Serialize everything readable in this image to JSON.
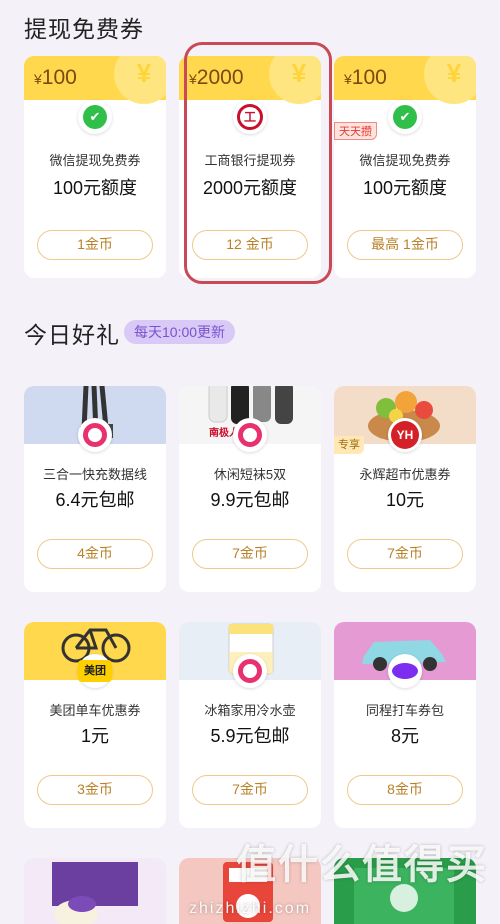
{
  "sections": {
    "withdraw_title": "提现免费券",
    "daily_title": "今日好礼",
    "daily_badge": "每天10:00更新"
  },
  "withdraw_cards": [
    {
      "amount_symbol": "¥",
      "amount": "100",
      "coin_mark": "¥",
      "logo": "wechat-pay-icon",
      "name": "微信提现免费券",
      "value": "100元额度",
      "button": "1金币"
    },
    {
      "amount_symbol": "¥",
      "amount": "2000",
      "coin_mark": "¥",
      "logo": "icbc-logo-icon",
      "name": "工商银行提现券",
      "value": "2000元额度",
      "button": "12 金币"
    },
    {
      "amount_symbol": "¥",
      "amount": "100",
      "coin_mark": "¥",
      "logo": "wechat-pay-icon",
      "tag": "天天攒",
      "name": "微信提现免费券",
      "value": "100元额度",
      "button": "最高 1金币"
    }
  ],
  "gift_cards_row1": [
    {
      "image": "usb-cable-product-image",
      "logo": "store-logo-icon",
      "name": "三合一快充数据线",
      "value": "6.4元包邮",
      "button": "4金币"
    },
    {
      "image": "socks-product-image",
      "image_text": "南极人",
      "logo": "store-logo-icon",
      "name": "休闲短袜5双",
      "value": "9.9元包邮",
      "button": "7金币"
    },
    {
      "image": "vegetables-basket-image",
      "logo": "yonghui-logo-icon",
      "logo_text": "YH",
      "tag": "专享",
      "name": "永辉超市优惠券",
      "value": "10元",
      "button": "7金币"
    }
  ],
  "gift_cards_row2": [
    {
      "image": "bicycle-image",
      "logo": "meituan-logo-icon",
      "logo_text": "美团",
      "name": "美团单车优惠券",
      "value": "1元",
      "button": "3金币"
    },
    {
      "image": "water-pitcher-image",
      "logo": "store-logo-icon",
      "name": "冰箱家用冷水壶",
      "value": "5.9元包邮",
      "button": "7金币"
    },
    {
      "image": "car-image",
      "logo": "tongcheng-logo-icon",
      "name": "同程打车券包",
      "value": "8元",
      "button": "8金币"
    }
  ],
  "watermark": {
    "logo_text": "值什么值得买",
    "url": "zhizhizhi.com"
  },
  "colors": {
    "coupon_head": "#ffd84d",
    "button_border": "#eec98b",
    "button_text": "#b9822a",
    "highlight": "#c94a57",
    "badge_bg": "#d9c9f6"
  }
}
